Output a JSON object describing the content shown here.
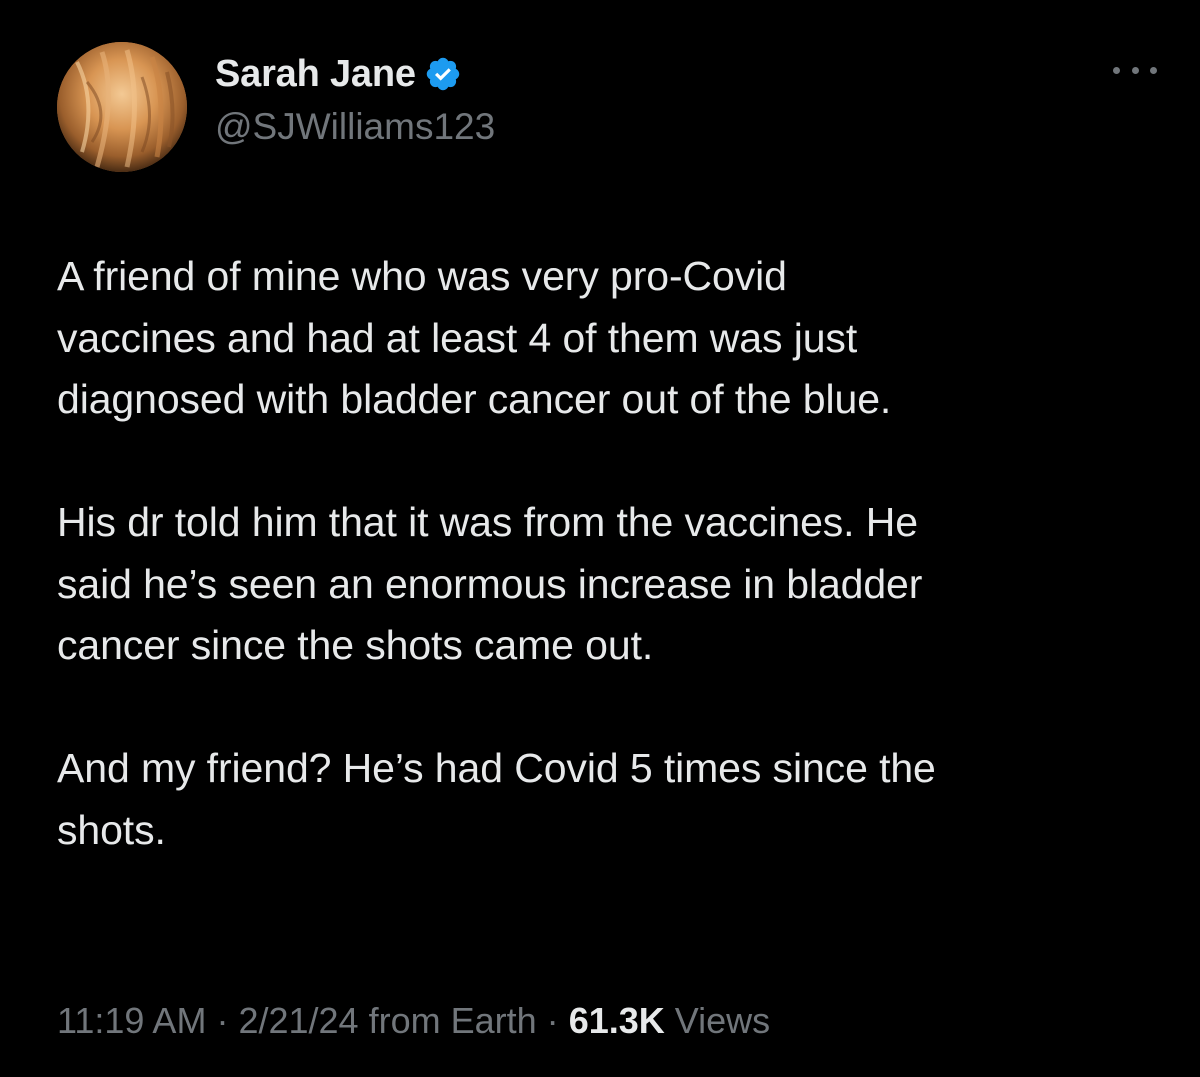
{
  "author": {
    "display_name": "Sarah Jane",
    "handle": "@SJWilliams123",
    "verified": true,
    "verified_color": "#1d9bf0"
  },
  "tweet": {
    "paragraphs": [
      "A friend of mine who was very pro-Covid\nvaccines and had at least 4 of them was just\ndiagnosed with bladder cancer out of the blue.",
      "His dr told him that it was from the vaccines. He\nsaid he’s seen an enormous increase in bladder\ncancer since the shots came out.",
      "And my friend? He’s had Covid 5 times since the\nshots."
    ]
  },
  "meta": {
    "time": "11:19 AM",
    "separator": "·",
    "date": "2/21/24",
    "source": "from Earth",
    "views_count": "61.3K",
    "views_label": "Views"
  },
  "icons": {
    "more": "more-horizontal-icon",
    "verified": "verified-badge-icon"
  },
  "colors": {
    "background": "#000000",
    "primary_text": "#e7e9ea",
    "secondary_text": "#71767b"
  }
}
